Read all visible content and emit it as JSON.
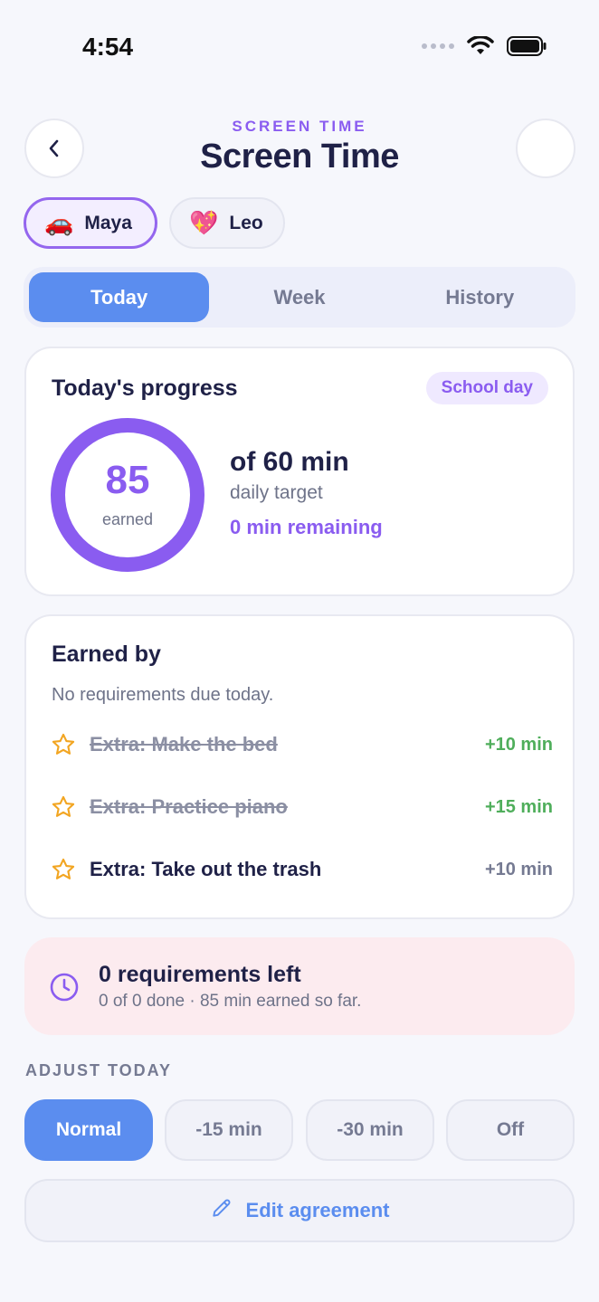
{
  "status_bar": {
    "time": "4:54"
  },
  "header": {
    "eyebrow": "SCREEN TIME",
    "title": "Screen Time"
  },
  "kids": [
    {
      "name": "Maya",
      "emoji": "🚗",
      "selected": true
    },
    {
      "name": "Leo",
      "emoji": "💖",
      "selected": false
    }
  ],
  "tabs": [
    {
      "label": "Today",
      "active": true
    },
    {
      "label": "Week",
      "active": false
    },
    {
      "label": "History",
      "active": false
    }
  ],
  "progress": {
    "heading": "Today's progress",
    "badge": "School day",
    "earned_value": "85",
    "earned_label": "earned",
    "target_main": "of 60 min",
    "target_sub": "daily target",
    "remaining": "0 min remaining",
    "ring_fill_fraction": 1.0
  },
  "earned_by": {
    "heading": "Earned by",
    "subtitle": "No requirements due today.",
    "tasks": [
      {
        "label": "Extra: Make the bed",
        "minutes": "+10 min",
        "done": true
      },
      {
        "label": "Extra: Practice piano",
        "minutes": "+15 min",
        "done": true
      },
      {
        "label": "Extra: Take out the trash",
        "minutes": "+10 min",
        "done": false
      }
    ]
  },
  "requirements_alert": {
    "title": "0 requirements left",
    "subtitle": "0 of 0 done · 85 min earned so far."
  },
  "adjust": {
    "label": "ADJUST TODAY",
    "options": [
      {
        "label": "Normal",
        "active": true
      },
      {
        "label": "-15 min",
        "active": false
      },
      {
        "label": "-30 min",
        "active": false
      },
      {
        "label": "Off",
        "active": false
      }
    ]
  },
  "edit_agreement": {
    "label": "Edit agreement"
  },
  "colors": {
    "accent_purple": "#8a5cf0",
    "accent_blue": "#5b8def",
    "success_green": "#4fae5b",
    "star_orange": "#f2a521",
    "alert_bg": "#fcebef"
  }
}
